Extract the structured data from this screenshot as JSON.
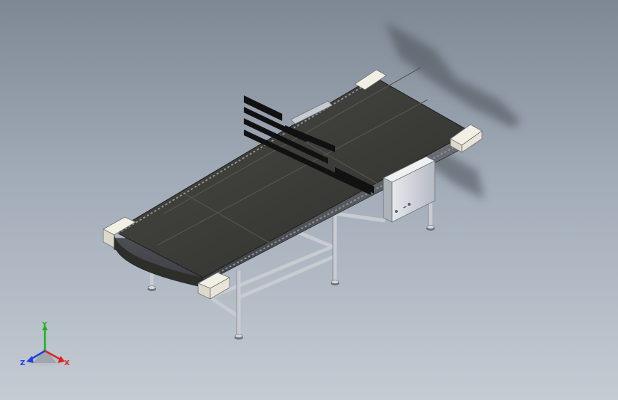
{
  "viewport": {
    "background_top": "#7e8894",
    "background_bottom": "#c4cbd3"
  },
  "model": {
    "description_icon": "conveyor-3d-model",
    "belt_color": "#3a3a36",
    "frame_color": "#c8ccd2",
    "end_cap_color": "#f0ece0"
  },
  "triad": {
    "x_label": "X",
    "y_label": "Y",
    "z_label": "Z",
    "x_color": "#e02020",
    "y_color": "#20b020",
    "z_color": "#2040e0"
  }
}
